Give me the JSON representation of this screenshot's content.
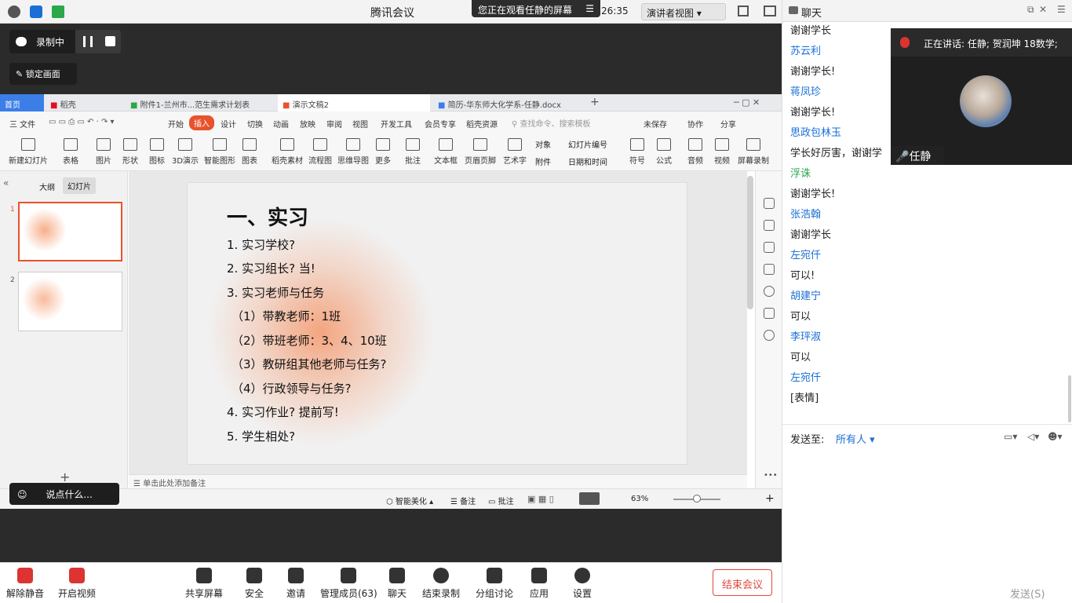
{
  "window": {
    "title": "腾讯会议",
    "viewing_banner": "您正在观看任静的屏幕",
    "clock": ":26:35",
    "presenter_view": "演讲者视图"
  },
  "recording": {
    "status": "录制中",
    "lock": "锁定画面"
  },
  "wps": {
    "tabs": [
      {
        "label": "首页"
      },
      {
        "label": "稻壳"
      },
      {
        "label": "附件1-兰州市...范生需求计划表"
      },
      {
        "label": "演示文稿2"
      },
      {
        "label": "简历-华东师大化学系-任静.docx"
      }
    ],
    "menus": [
      "三 文件",
      "开始",
      "插入",
      "设计",
      "切换",
      "动画",
      "放映",
      "审阅",
      "视图",
      "开发工具",
      "会员专享",
      "稻壳资源"
    ],
    "search_placeholder": "查找命令、搜索模板",
    "right_menu": [
      "未保存",
      "协作",
      "分享"
    ],
    "ribbon": [
      "新建幻灯片",
      "表格",
      "图片",
      "形状",
      "图标",
      "3D演示",
      "智能图形",
      "图表",
      "稻壳素材",
      "流程图",
      "思维导图",
      "更多",
      "批注",
      "文本框",
      "页眉页脚",
      "艺术字",
      "对象",
      "幻灯片编号",
      "附件",
      "日期和时间",
      "符号",
      "公式",
      "音频",
      "视频",
      "屏幕录制"
    ],
    "pane_tabs": [
      "大纲",
      "幻灯片"
    ],
    "slide_numbers": [
      "1",
      "2"
    ],
    "slide": {
      "title": "一、实习",
      "lines": [
        "1. 实习学校?",
        "2. 实习组长? 当!",
        "3. 实习老师与任务",
        "（1）带教老师：1班",
        "（2）带班老师：3、4、10班",
        "（3）教研组其他老师与任务?",
        "（4）行政领导与任务?",
        "4. 实习作业? 提前写!",
        "5. 学生相处?"
      ]
    },
    "notes_placeholder": "单击此处添加备注",
    "status": {
      "smart": "智能美化",
      "notes": "备注",
      "comment": "批注",
      "zoom": "63%"
    }
  },
  "say_something": "说点什么...",
  "bottombar": {
    "items": [
      "解除静音",
      "开启视频",
      "共享屏幕",
      "安全",
      "邀请",
      "管理成员(63)",
      "聊天",
      "结束录制",
      "分组讨论",
      "应用",
      "设置"
    ],
    "end": "结束会议"
  },
  "chat": {
    "title": "聊天",
    "speaking": "正在讲话: 任静; 贺润坤 18数学;",
    "video_name": "任静",
    "messages": [
      {
        "text": "谢谢学长",
        "type": "msg"
      },
      {
        "text": "苏云利",
        "type": "name"
      },
      {
        "text": "谢谢学长!",
        "type": "msg"
      },
      {
        "text": "蒋凤珍",
        "type": "name"
      },
      {
        "text": "谢谢学长!",
        "type": "msg"
      },
      {
        "text": "思政包林玉",
        "type": "name"
      },
      {
        "text": "学长好厉害，谢谢学",
        "type": "msg"
      },
      {
        "text": "浮诛",
        "type": "name-green"
      },
      {
        "text": "谢谢学长!",
        "type": "msg"
      },
      {
        "text": "张浩翰",
        "type": "name"
      },
      {
        "text": "谢谢学长",
        "type": "msg"
      },
      {
        "text": "左宛仟",
        "type": "name"
      },
      {
        "text": "可以!",
        "type": "msg"
      },
      {
        "text": "胡建宁",
        "type": "name"
      },
      {
        "text": "可以",
        "type": "msg"
      },
      {
        "text": "李玶淑",
        "type": "name"
      },
      {
        "text": "可以",
        "type": "msg"
      },
      {
        "text": "左宛仟",
        "type": "name"
      },
      {
        "text": "[表情]",
        "type": "msg"
      }
    ],
    "send_to_label": "发送至:",
    "send_to_value": "所有人 ▾",
    "send_button": "发送(S)"
  }
}
